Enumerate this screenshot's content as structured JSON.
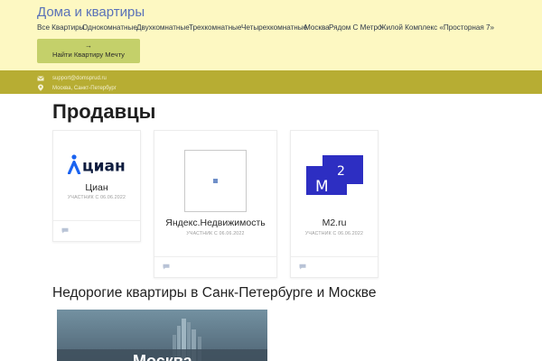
{
  "site": {
    "title": "Дома и квартиры"
  },
  "nav": {
    "items": [
      "Все Квартиры",
      "Однокомнатные",
      "Двухкомнатные",
      "Трехкомнатные",
      "Четырехкомнатные",
      "Москва",
      "Рядом С Метро",
      "Жилой Комплекс «Просторная 7»"
    ]
  },
  "cta": {
    "arrow": "→",
    "label": "Найти Квартиру Мечту"
  },
  "info": {
    "email": "support@domsprud.ru",
    "location": "Москва, Санкт-Петербург"
  },
  "page": {
    "title": "Продавцы"
  },
  "sellers": [
    {
      "name": "Циан",
      "logo_text": "циан",
      "since": "УЧАСТНИК С 06.06.2022"
    },
    {
      "name": "Яндекс.Недвижимость",
      "logo_text": "",
      "since": "УЧАСТНИК С 06.06.2022"
    },
    {
      "name": "M2.ru",
      "logo_text": "M",
      "logo_sup": "2",
      "since": "УЧАСТНИК С 06.06.2022"
    }
  ],
  "section": {
    "title": "Недорогие квартиры в Санк-Петербурге и Москве"
  },
  "banner": {
    "text": "Москва"
  },
  "colors": {
    "header_bg": "#fdf8c2",
    "infobar_bg": "#b7ad33",
    "cta_bg": "#c4d06a",
    "title_link": "#5a72b8",
    "cian_blue": "#1a63f0",
    "m2_blue": "#2d2ec2"
  }
}
